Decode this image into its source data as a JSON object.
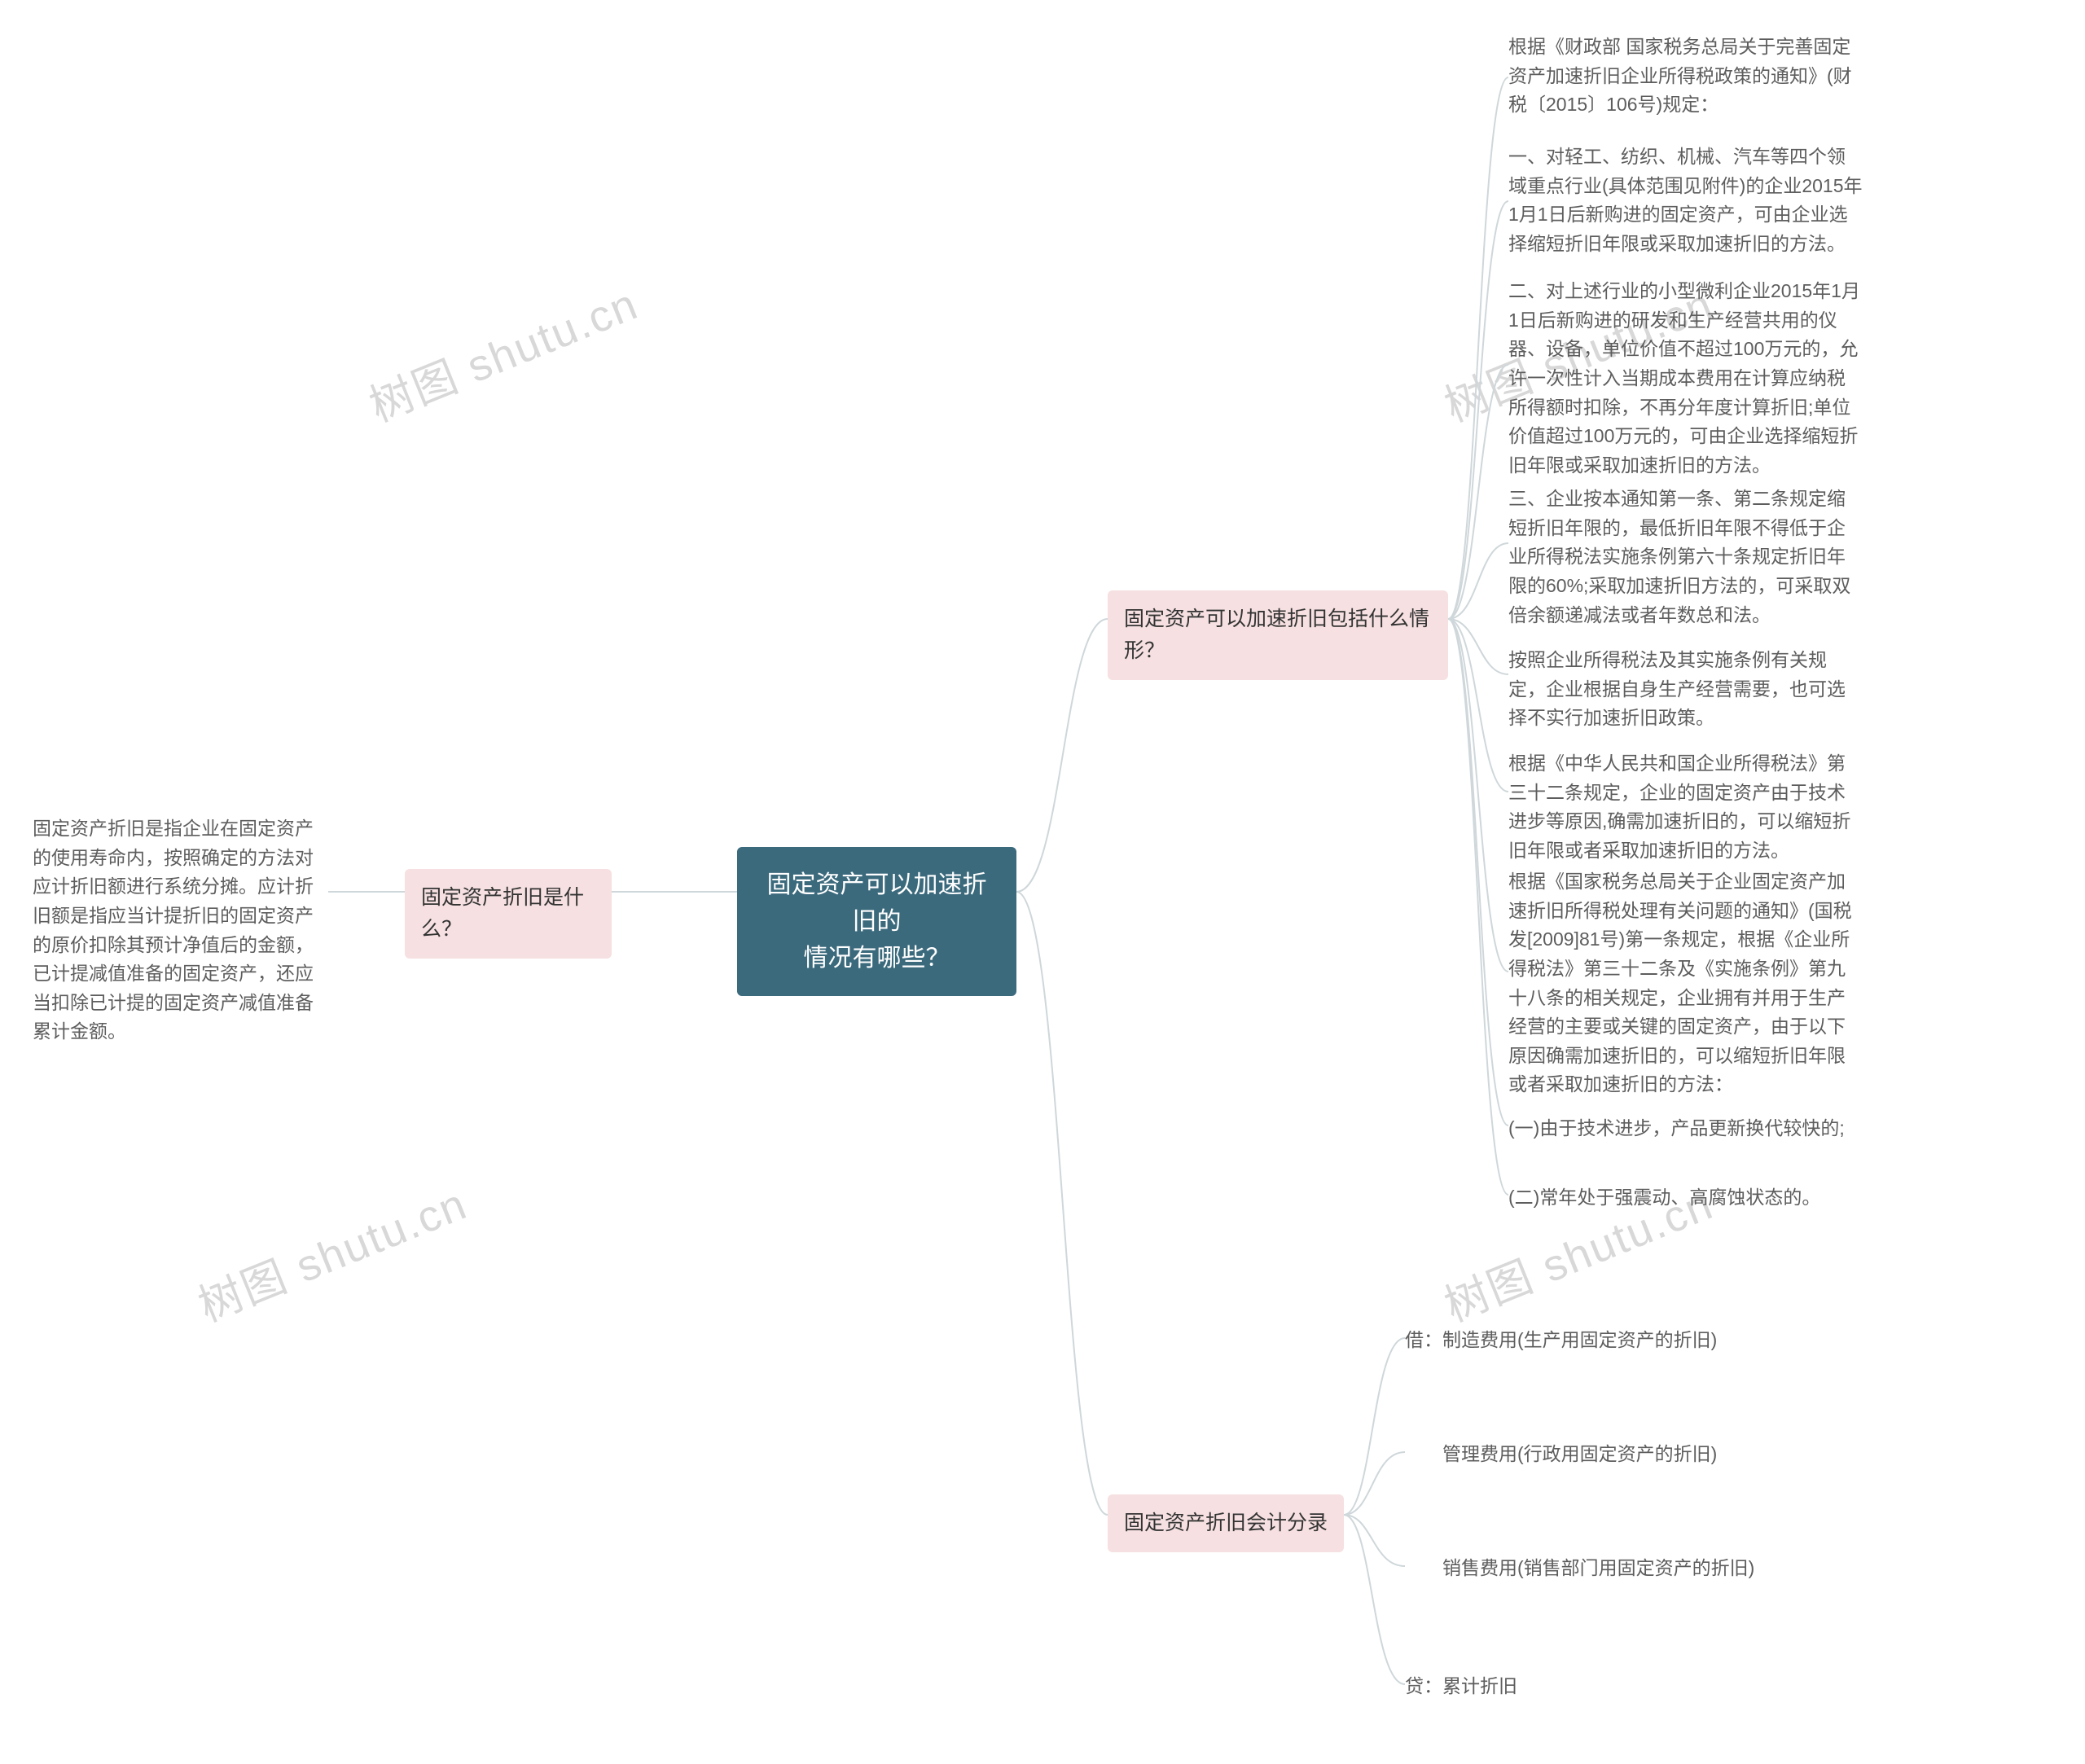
{
  "watermarks": [
    "树图 shutu.cn",
    "树图 shutu.cn",
    "树图 shutu.cn",
    "树图 shutu.cn"
  ],
  "root": {
    "title_line1": "固定资产可以加速折旧的",
    "title_line2": "情况有哪些？"
  },
  "left": {
    "branch1": {
      "label": "固定资产折旧是什么？",
      "leaf": "固定资产折旧是指企业在固定资产的使用寿命内，按照确定的方法对应计折旧额进行系统分摊。应计折旧额是指应当计提折旧的固定资产的原价扣除其预计净值后的金额，已计提减值准备的固定资产，还应当扣除已计提的固定资产减值准备累计金额。"
    }
  },
  "right": {
    "branch1": {
      "label": "固定资产可以加速折旧包括什么情形？",
      "leaves": [
        "根据《财政部 国家税务总局关于完善固定资产加速折旧企业所得税政策的通知》(财税〔2015〕106号)规定：",
        "一、对轻工、纺织、机械、汽车等四个领域重点行业(具体范围见附件)的企业2015年1月1日后新购进的固定资产，可由企业选择缩短折旧年限或采取加速折旧的方法。",
        "二、对上述行业的小型微利企业2015年1月1日后新购进的研发和生产经营共用的仪器、设备，单位价值不超过100万元的，允许一次性计入当期成本费用在计算应纳税所得额时扣除，不再分年度计算折旧;单位价值超过100万元的，可由企业选择缩短折旧年限或采取加速折旧的方法。",
        "三、企业按本通知第一条、第二条规定缩短折旧年限的，最低折旧年限不得低于企业所得税法实施条例第六十条规定折旧年限的60%;采取加速折旧方法的，可采取双倍余额递减法或者年数总和法。",
        "按照企业所得税法及其实施条例有关规定，企业根据自身生产经营需要，也可选择不实行加速折旧政策。",
        "根据《中华人民共和国企业所得税法》第三十二条规定，企业的固定资产由于技术进步等原因,确需加速折旧的，可以缩短折旧年限或者采取加速折旧的方法。",
        "根据《国家税务总局关于企业固定资产加速折旧所得税处理有关问题的通知》(国税发[2009]81号)第一条规定，根据《企业所得税法》第三十二条及《实施条例》第九十八条的相关规定，企业拥有并用于生产经营的主要或关键的固定资产，由于以下原因确需加速折旧的，可以缩短折旧年限或者采取加速折旧的方法：",
        "(一)由于技术进步，产品更新换代较快的;",
        "(二)常年处于强震动、高腐蚀状态的。"
      ]
    },
    "branch2": {
      "label": "固定资产折旧会计分录",
      "leaves": [
        "借：制造费用(生产用固定资产的折旧)",
        "　　管理费用(行政用固定资产的折旧)",
        "　　销售费用(销售部门用固定资产的折旧)",
        "贷：累计折旧"
      ]
    }
  }
}
